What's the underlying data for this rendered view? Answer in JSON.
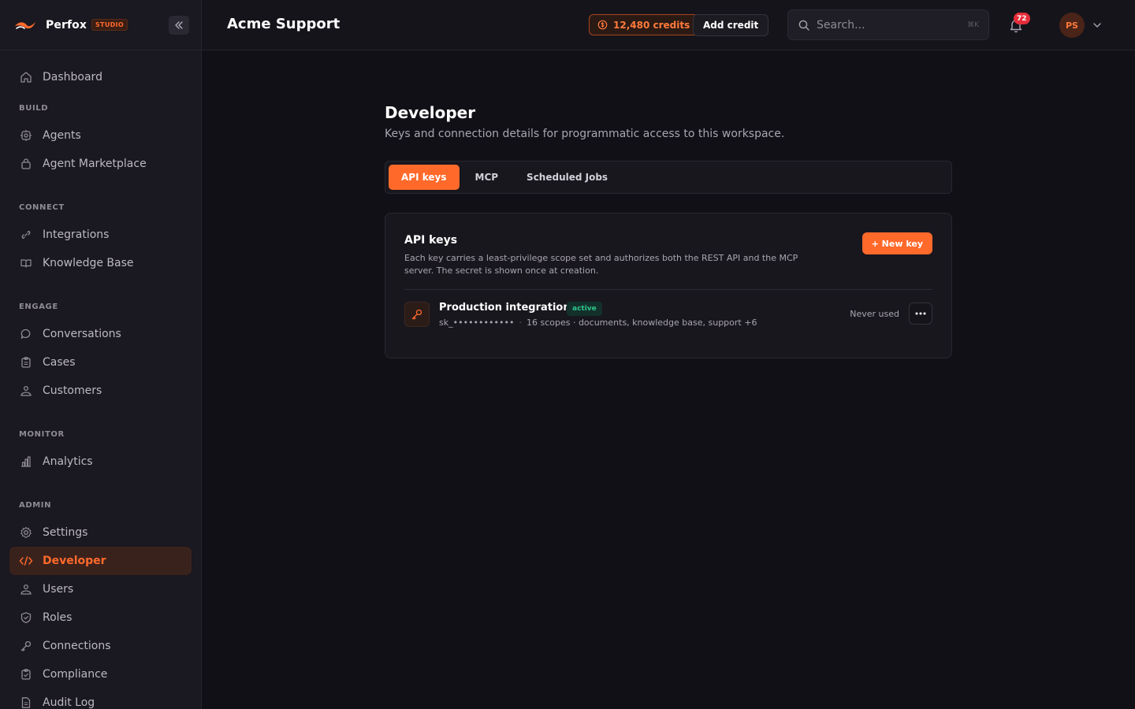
{
  "brand": {
    "name": "Perfox",
    "badge": "STUDIO"
  },
  "sidebar": {
    "items": [
      {
        "label": "Dashboard",
        "icon": "home-icon"
      }
    ],
    "sections": [
      {
        "title": "BUILD",
        "items": [
          {
            "label": "Agents",
            "icon": "cog-icon"
          },
          {
            "label": "Agent Marketplace",
            "icon": "bag-icon"
          }
        ]
      },
      {
        "title": "CONNECT",
        "items": [
          {
            "label": "Integrations",
            "icon": "link-icon"
          },
          {
            "label": "Knowledge Base",
            "icon": "book-icon"
          }
        ]
      },
      {
        "title": "ENGAGE",
        "items": [
          {
            "label": "Conversations",
            "icon": "chat-icon"
          },
          {
            "label": "Cases",
            "icon": "clipboard-icon"
          },
          {
            "label": "Customers",
            "icon": "people-icon"
          }
        ]
      },
      {
        "title": "MONITOR",
        "items": [
          {
            "label": "Analytics",
            "icon": "bar-chart-icon"
          }
        ]
      },
      {
        "title": "ADMIN",
        "items": [
          {
            "label": "Settings",
            "icon": "gear-icon"
          },
          {
            "label": "Developer",
            "icon": "code-icon",
            "active": true
          },
          {
            "label": "Users",
            "icon": "people-icon"
          },
          {
            "label": "Roles",
            "icon": "shield-icon"
          },
          {
            "label": "Connections",
            "icon": "key-icon"
          },
          {
            "label": "Compliance",
            "icon": "clipboard-check-icon"
          },
          {
            "label": "Audit Log",
            "icon": "document-icon"
          }
        ]
      }
    ]
  },
  "header": {
    "workspace": "Acme Support",
    "credits": "12,480 credits",
    "add_credit": "Add credit",
    "search_placeholder": "Search...",
    "search_shortcut": "⌘K",
    "notifications": "72",
    "avatar_initials": "PS"
  },
  "page": {
    "title": "Developer",
    "subtitle": "Keys and connection details for programmatic access to this workspace.",
    "tabs": [
      {
        "label": "API keys",
        "active": true
      },
      {
        "label": "MCP"
      },
      {
        "label": "Scheduled Jobs"
      }
    ],
    "card": {
      "title": "API keys",
      "description": "Each key carries a least-privilege scope set and authorizes both the REST API and the MCP server. The secret is shown once at creation.",
      "new_key_label": "+ New key",
      "keys": [
        {
          "name": "Production integration",
          "status": "active",
          "prefix": "sk_••••••••••••",
          "scopes": "16 scopes · documents, knowledge base, support +6",
          "last_used": "Never used"
        }
      ]
    }
  },
  "colors": {
    "accent": "#ff6a2b",
    "background": "#111016",
    "sidebar": "#1a1820",
    "status_active": "#2fc48d"
  }
}
